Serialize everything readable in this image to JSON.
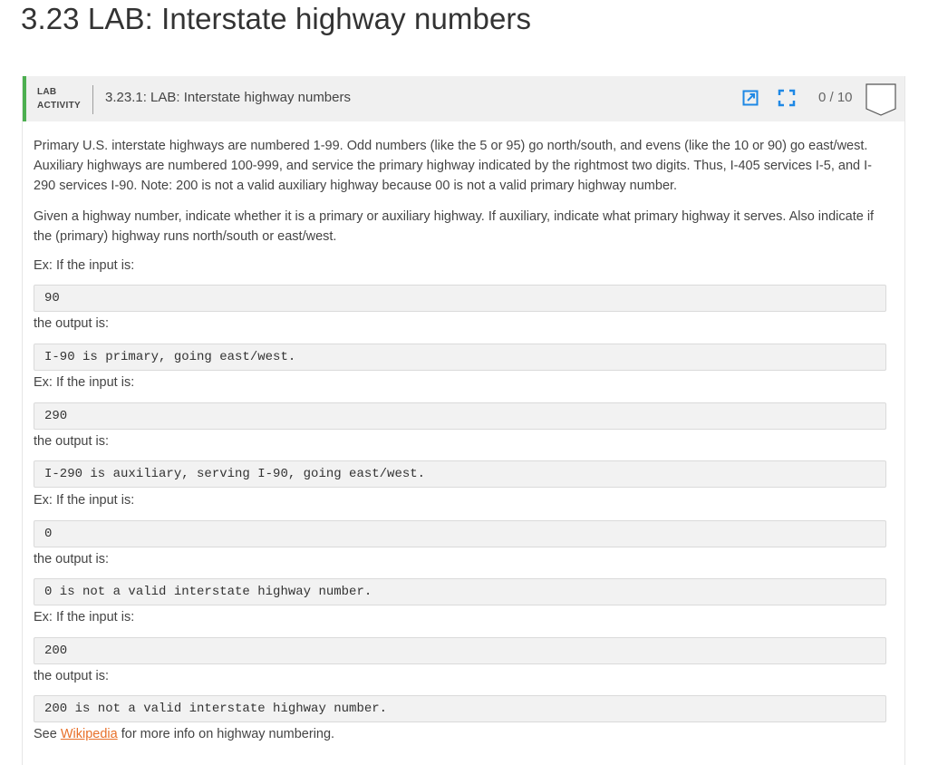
{
  "page": {
    "title": "3.23 LAB: Interstate highway numbers"
  },
  "lab": {
    "tag_line1": "LAB",
    "tag_line2": "ACTIVITY",
    "title": "3.23.1: LAB: Interstate highway numbers",
    "score": "0 / 10",
    "accent_color": "#4caf50",
    "icons": [
      "open-external-icon",
      "fullscreen-icon",
      "score-badge-icon"
    ]
  },
  "content": {
    "para1": "Primary U.S. interstate highways are numbered 1-99. Odd numbers (like the 5 or 95) go north/south, and evens (like the 10 or 90) go east/west. Auxiliary highways are numbered 100-999, and service the primary highway indicated by the rightmost two digits. Thus, I-405 services I-5, and I-290 services I-90. Note: 200 is not a valid auxiliary highway because 00 is not a valid primary highway number.",
    "para2": "Given a highway number, indicate whether it is a primary or auxiliary highway. If auxiliary, indicate what primary highway it serves. Also indicate if the (primary) highway runs north/south or east/west.",
    "examples": [
      {
        "input_label": "Ex: If the input is:",
        "input": "90",
        "output_label": "the output is:",
        "output": "I-90 is primary, going east/west."
      },
      {
        "input_label": "Ex: If the input is:",
        "input": "290",
        "output_label": "the output is:",
        "output": "I-290 is auxiliary, serving I-90, going east/west."
      },
      {
        "input_label": "Ex: If the input is:",
        "input": "0",
        "output_label": "the output is:",
        "output": "0 is not a valid interstate highway number."
      },
      {
        "input_label": "Ex: If the input is:",
        "input": "200",
        "output_label": "the output is:",
        "output": "200 is not a valid interstate highway number."
      }
    ],
    "footer_prefix": "See ",
    "footer_link": "Wikipedia",
    "footer_suffix": " for more info on highway numbering.",
    "link_color": "#e8702a"
  }
}
